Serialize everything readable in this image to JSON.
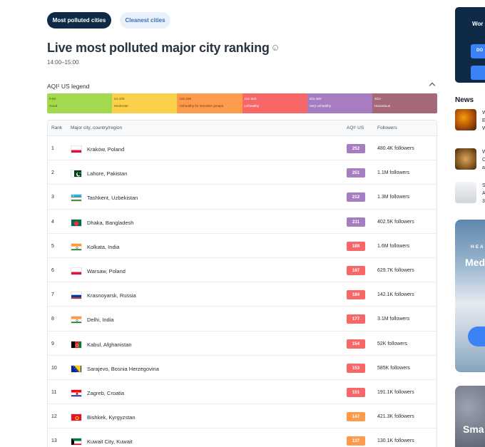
{
  "tabs": {
    "active": "Most polluted cities",
    "inactive": "Cleanest cities"
  },
  "page": {
    "title": "Live most polluted major city ranking",
    "time": "14:00–15:00"
  },
  "legend": {
    "title": "AQI¹ US legend",
    "levels": [
      {
        "range": "0-50",
        "label": "Good",
        "color": "#a3d94f",
        "text": "#3f5b10"
      },
      {
        "range": "51-100",
        "label": "Moderate",
        "color": "#fbd04b",
        "text": "#6b5200"
      },
      {
        "range": "101-150",
        "label": "Unhealthy for sensitive groups",
        "color": "#fb9b4b",
        "text": "#7a3a00"
      },
      {
        "range": "151-200",
        "label": "Unhealthy",
        "color": "#f86768",
        "text": "#ffffff"
      },
      {
        "range": "201-300",
        "label": "Very unhealthy",
        "color": "#a77dc2",
        "text": "#ffffff"
      },
      {
        "range": "301+",
        "label": "Hazardous",
        "color": "#a46877",
        "text": "#ffffff"
      }
    ]
  },
  "table": {
    "headers": {
      "rank": "Rank",
      "city": "Major city, country/region",
      "aqi": "AQI¹ US",
      "followers": "Followers"
    },
    "rows": [
      {
        "rank": "1",
        "city": "Kraków, Poland",
        "aqi": "252",
        "followers": "480.4K followers",
        "flag": "poland",
        "color": "#a77dc2"
      },
      {
        "rank": "2",
        "city": "Lahore, Pakistan",
        "aqi": "251",
        "followers": "1.1M followers",
        "flag": "pakistan",
        "color": "#a77dc2"
      },
      {
        "rank": "3",
        "city": "Tashkent, Uzbekistan",
        "aqi": "212",
        "followers": "1.3M followers",
        "flag": "uzbekistan",
        "color": "#a77dc2"
      },
      {
        "rank": "4",
        "city": "Dhaka, Bangladesh",
        "aqi": "211",
        "followers": "402.5K followers",
        "flag": "bangladesh",
        "color": "#a77dc2"
      },
      {
        "rank": "5",
        "city": "Kolkata, India",
        "aqi": "189",
        "followers": "1.6M followers",
        "flag": "india",
        "color": "#f86768"
      },
      {
        "rank": "6",
        "city": "Warsaw, Poland",
        "aqi": "187",
        "followers": "629.7K followers",
        "flag": "poland",
        "color": "#f86768"
      },
      {
        "rank": "7",
        "city": "Krasnoyarsk, Russia",
        "aqi": "184",
        "followers": "142.1K followers",
        "flag": "russia",
        "color": "#f86768"
      },
      {
        "rank": "8",
        "city": "Delhi, India",
        "aqi": "177",
        "followers": "3.1M followers",
        "flag": "india",
        "color": "#f86768"
      },
      {
        "rank": "9",
        "city": "Kabul, Afghanistan",
        "aqi": "154",
        "followers": "52K followers",
        "flag": "afghanistan",
        "color": "#f86768"
      },
      {
        "rank": "10",
        "city": "Sarajevo, Bosnia Herzegovina",
        "aqi": "153",
        "followers": "585K followers",
        "flag": "bosnia",
        "color": "#f86768"
      },
      {
        "rank": "11",
        "city": "Zagreb, Croatia",
        "aqi": "151",
        "followers": "191.1K followers",
        "flag": "croatia",
        "color": "#f86768"
      },
      {
        "rank": "12",
        "city": "Bishkek, Kyrgyzstan",
        "aqi": "147",
        "followers": "421.3K followers",
        "flag": "kyrgyzstan",
        "color": "#fb9b4b"
      },
      {
        "rank": "13",
        "city": "Kuwait City, Kuwait",
        "aqi": "137",
        "followers": "130.1K followers",
        "flag": "kuwait",
        "color": "#fb9b4b"
      }
    ]
  },
  "sidebar": {
    "card_text": "Wor",
    "card_button": "DO",
    "news_title": "News",
    "news": [
      {
        "l1": "W",
        "l2": "E",
        "l3": "W"
      },
      {
        "l1": "W",
        "l2": "C",
        "l3": "a"
      },
      {
        "l1": "S",
        "l2": "A",
        "l3": "3"
      }
    ],
    "ad1_small": "HEA",
    "ad1_big": "Med",
    "ad2_text": "Sma"
  }
}
